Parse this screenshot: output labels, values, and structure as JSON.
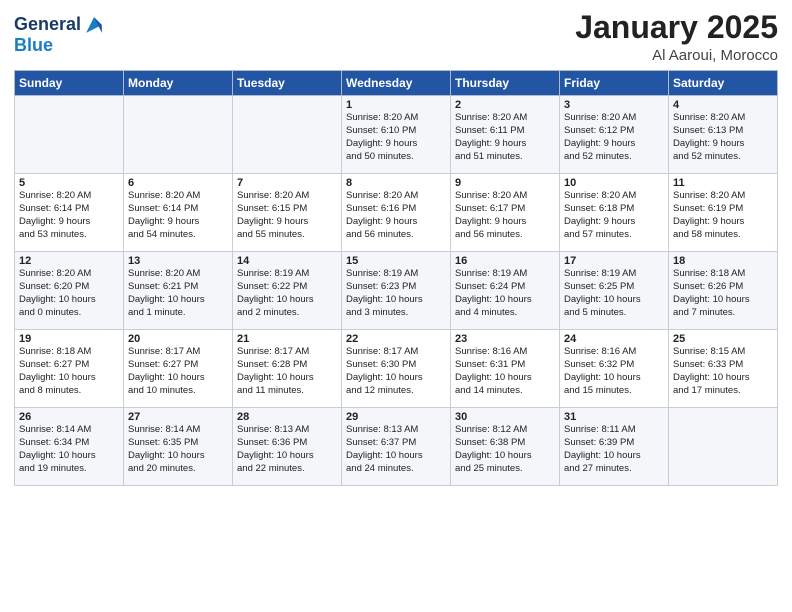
{
  "header": {
    "logo_line1": "General",
    "logo_line2": "Blue",
    "title": "January 2025",
    "subtitle": "Al Aaroui, Morocco"
  },
  "weekdays": [
    "Sunday",
    "Monday",
    "Tuesday",
    "Wednesday",
    "Thursday",
    "Friday",
    "Saturday"
  ],
  "weeks": [
    [
      {
        "day": "",
        "info": ""
      },
      {
        "day": "",
        "info": ""
      },
      {
        "day": "",
        "info": ""
      },
      {
        "day": "1",
        "info": "Sunrise: 8:20 AM\nSunset: 6:10 PM\nDaylight: 9 hours\nand 50 minutes."
      },
      {
        "day": "2",
        "info": "Sunrise: 8:20 AM\nSunset: 6:11 PM\nDaylight: 9 hours\nand 51 minutes."
      },
      {
        "day": "3",
        "info": "Sunrise: 8:20 AM\nSunset: 6:12 PM\nDaylight: 9 hours\nand 52 minutes."
      },
      {
        "day": "4",
        "info": "Sunrise: 8:20 AM\nSunset: 6:13 PM\nDaylight: 9 hours\nand 52 minutes."
      }
    ],
    [
      {
        "day": "5",
        "info": "Sunrise: 8:20 AM\nSunset: 6:14 PM\nDaylight: 9 hours\nand 53 minutes."
      },
      {
        "day": "6",
        "info": "Sunrise: 8:20 AM\nSunset: 6:14 PM\nDaylight: 9 hours\nand 54 minutes."
      },
      {
        "day": "7",
        "info": "Sunrise: 8:20 AM\nSunset: 6:15 PM\nDaylight: 9 hours\nand 55 minutes."
      },
      {
        "day": "8",
        "info": "Sunrise: 8:20 AM\nSunset: 6:16 PM\nDaylight: 9 hours\nand 56 minutes."
      },
      {
        "day": "9",
        "info": "Sunrise: 8:20 AM\nSunset: 6:17 PM\nDaylight: 9 hours\nand 56 minutes."
      },
      {
        "day": "10",
        "info": "Sunrise: 8:20 AM\nSunset: 6:18 PM\nDaylight: 9 hours\nand 57 minutes."
      },
      {
        "day": "11",
        "info": "Sunrise: 8:20 AM\nSunset: 6:19 PM\nDaylight: 9 hours\nand 58 minutes."
      }
    ],
    [
      {
        "day": "12",
        "info": "Sunrise: 8:20 AM\nSunset: 6:20 PM\nDaylight: 10 hours\nand 0 minutes."
      },
      {
        "day": "13",
        "info": "Sunrise: 8:20 AM\nSunset: 6:21 PM\nDaylight: 10 hours\nand 1 minute."
      },
      {
        "day": "14",
        "info": "Sunrise: 8:19 AM\nSunset: 6:22 PM\nDaylight: 10 hours\nand 2 minutes."
      },
      {
        "day": "15",
        "info": "Sunrise: 8:19 AM\nSunset: 6:23 PM\nDaylight: 10 hours\nand 3 minutes."
      },
      {
        "day": "16",
        "info": "Sunrise: 8:19 AM\nSunset: 6:24 PM\nDaylight: 10 hours\nand 4 minutes."
      },
      {
        "day": "17",
        "info": "Sunrise: 8:19 AM\nSunset: 6:25 PM\nDaylight: 10 hours\nand 5 minutes."
      },
      {
        "day": "18",
        "info": "Sunrise: 8:18 AM\nSunset: 6:26 PM\nDaylight: 10 hours\nand 7 minutes."
      }
    ],
    [
      {
        "day": "19",
        "info": "Sunrise: 8:18 AM\nSunset: 6:27 PM\nDaylight: 10 hours\nand 8 minutes."
      },
      {
        "day": "20",
        "info": "Sunrise: 8:17 AM\nSunset: 6:27 PM\nDaylight: 10 hours\nand 10 minutes."
      },
      {
        "day": "21",
        "info": "Sunrise: 8:17 AM\nSunset: 6:28 PM\nDaylight: 10 hours\nand 11 minutes."
      },
      {
        "day": "22",
        "info": "Sunrise: 8:17 AM\nSunset: 6:30 PM\nDaylight: 10 hours\nand 12 minutes."
      },
      {
        "day": "23",
        "info": "Sunrise: 8:16 AM\nSunset: 6:31 PM\nDaylight: 10 hours\nand 14 minutes."
      },
      {
        "day": "24",
        "info": "Sunrise: 8:16 AM\nSunset: 6:32 PM\nDaylight: 10 hours\nand 15 minutes."
      },
      {
        "day": "25",
        "info": "Sunrise: 8:15 AM\nSunset: 6:33 PM\nDaylight: 10 hours\nand 17 minutes."
      }
    ],
    [
      {
        "day": "26",
        "info": "Sunrise: 8:14 AM\nSunset: 6:34 PM\nDaylight: 10 hours\nand 19 minutes."
      },
      {
        "day": "27",
        "info": "Sunrise: 8:14 AM\nSunset: 6:35 PM\nDaylight: 10 hours\nand 20 minutes."
      },
      {
        "day": "28",
        "info": "Sunrise: 8:13 AM\nSunset: 6:36 PM\nDaylight: 10 hours\nand 22 minutes."
      },
      {
        "day": "29",
        "info": "Sunrise: 8:13 AM\nSunset: 6:37 PM\nDaylight: 10 hours\nand 24 minutes."
      },
      {
        "day": "30",
        "info": "Sunrise: 8:12 AM\nSunset: 6:38 PM\nDaylight: 10 hours\nand 25 minutes."
      },
      {
        "day": "31",
        "info": "Sunrise: 8:11 AM\nSunset: 6:39 PM\nDaylight: 10 hours\nand 27 minutes."
      },
      {
        "day": "",
        "info": ""
      }
    ]
  ]
}
